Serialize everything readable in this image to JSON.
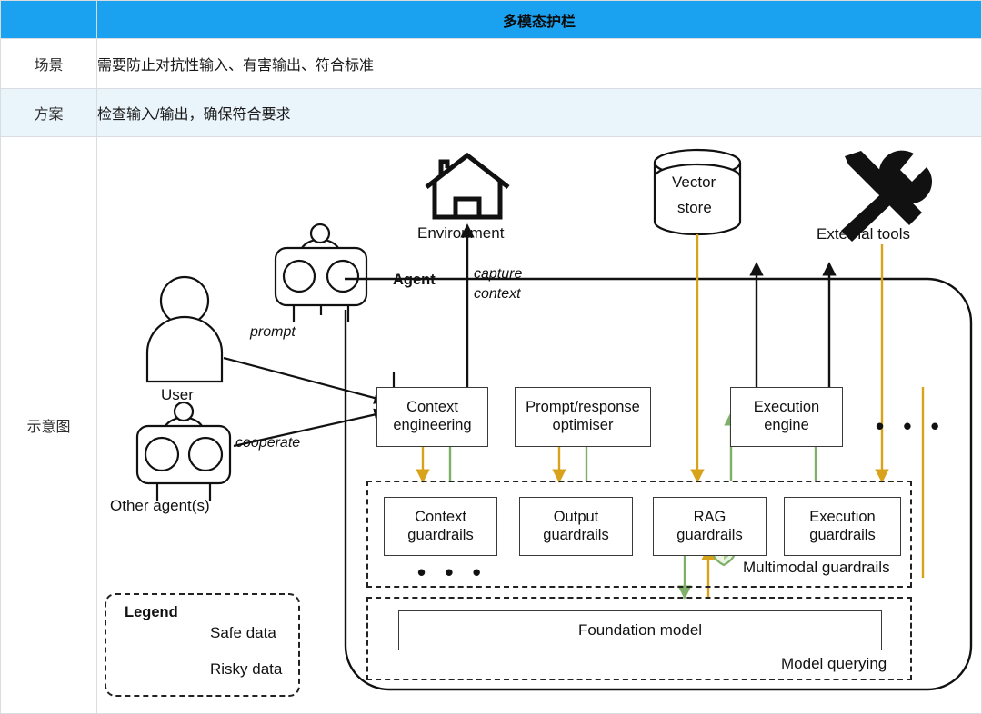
{
  "table": {
    "header": {
      "blank": "",
      "title": "多模态护栏"
    },
    "rows": [
      {
        "label": "场景",
        "value": "需要防止对抗性输入、有害输出、符合标准"
      },
      {
        "label": "方案",
        "value": "检查输入/输出，确保符合要求"
      },
      {
        "label": "示意图",
        "value": ""
      }
    ]
  },
  "diagram": {
    "external_nodes": {
      "environment": "Environment",
      "vector_store_line1": "Vector",
      "vector_store_line2": "store",
      "external_tools": "External tools"
    },
    "actors": {
      "agent": "Agent",
      "user": "User",
      "other_agents": "Other agent(s)"
    },
    "edge_labels": {
      "prompt": "prompt",
      "cooperate": "cooperate",
      "capture_context_line1": "capture",
      "capture_context_line2": "context"
    },
    "process_boxes": [
      {
        "line1": "Context",
        "line2": "engineering"
      },
      {
        "line1": "Prompt/response",
        "line2": "optimiser"
      },
      {
        "line1": "Execution",
        "line2": "engine"
      }
    ],
    "process_ellipsis": "• • •",
    "guardrail_boxes": [
      {
        "line1": "Context",
        "line2": "guardrails"
      },
      {
        "line1": "Output",
        "line2": "guardrails"
      },
      {
        "line1": "RAG",
        "line2": "guardrails"
      },
      {
        "line1": "Execution",
        "line2": "guardrails"
      }
    ],
    "guardrail_ellipsis": "• • •",
    "guardrail_group_label": "Multimodal guardrails",
    "model_box_label": "Foundation model",
    "model_group_label": "Model querying",
    "legend": {
      "title": "Legend",
      "items": [
        {
          "label": "Safe data",
          "color": "#7fb069"
        },
        {
          "label": "Risky data",
          "color": "#d9a21b"
        }
      ]
    },
    "colors": {
      "header_blue": "#1aa2f0",
      "row_alt": "#eaf4fb",
      "safe_green": "#7fb069",
      "risky_orange": "#d9a21b",
      "stroke": "#222222"
    }
  }
}
